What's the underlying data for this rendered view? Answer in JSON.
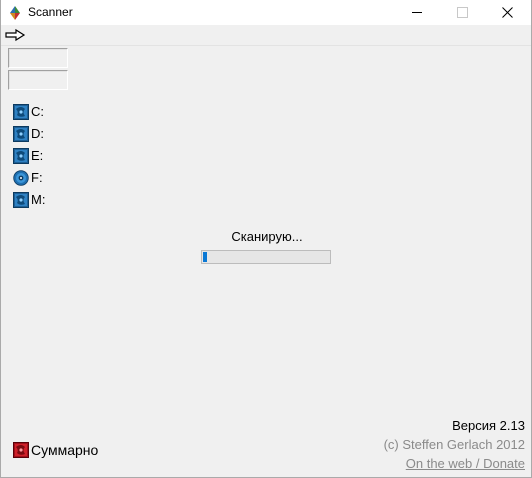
{
  "window": {
    "title": "Scanner",
    "app_icon": "scanner-app-icon"
  },
  "titlebar": {
    "buttons": [
      "minimize",
      "maximize",
      "close"
    ]
  },
  "toolbar": {
    "back_icon": "arrow-right-icon"
  },
  "fields": [
    "",
    ""
  ],
  "drives": [
    {
      "label": "C:",
      "icon": "hard-drive-icon",
      "accent": "#2a6fa8"
    },
    {
      "label": "D:",
      "icon": "hard-drive-icon",
      "accent": "#2a6fa8"
    },
    {
      "label": "E:",
      "icon": "hard-drive-icon",
      "accent": "#2a6fa8"
    },
    {
      "label": "F:",
      "icon": "optical-disc-icon",
      "accent": "#2a6fa8"
    },
    {
      "label": "M:",
      "icon": "hard-drive-icon",
      "accent": "#2a6fa8"
    }
  ],
  "scan": {
    "status": "Сканирую...",
    "progress": 0.03,
    "progress_color": "#0a78d4"
  },
  "summary": {
    "label": "Суммарно",
    "icon": "summary-pie-icon",
    "accent": "#c0141c"
  },
  "footer": {
    "version": "Версия 2.13",
    "copyright": "(c) Steffen Gerlach 2012",
    "link": "On the web / Donate"
  }
}
